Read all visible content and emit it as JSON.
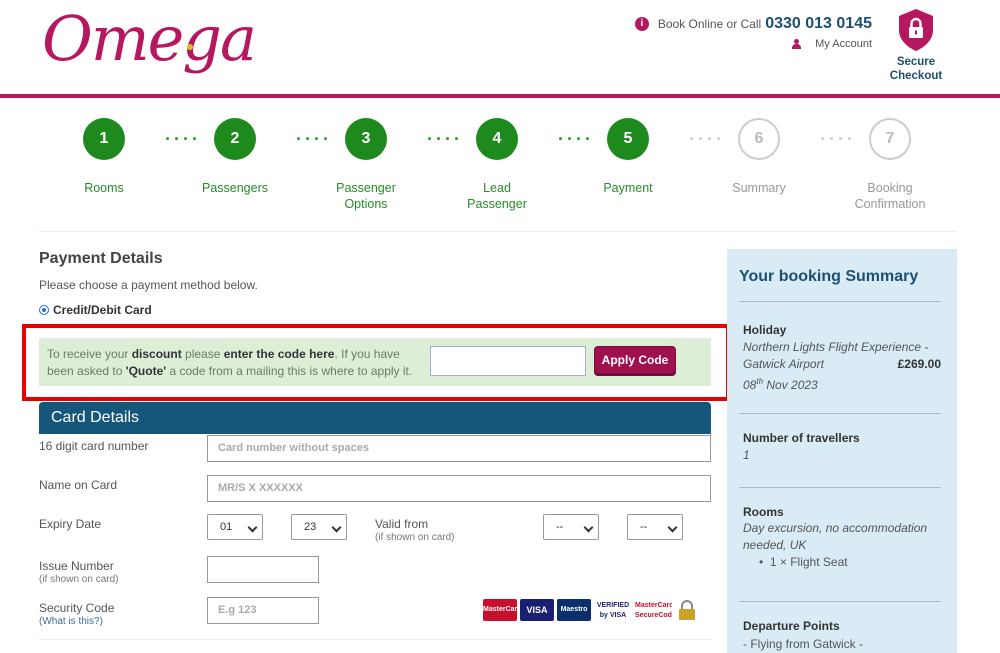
{
  "header": {
    "logo_text": "Omega",
    "call_text": "Book Online or Call",
    "phone": "0330 013 0145",
    "account_link": "My Account",
    "secure_line1": "Secure",
    "secure_line2": "Checkout"
  },
  "steps": [
    {
      "num": "1",
      "label": "Rooms",
      "state": "done"
    },
    {
      "num": "2",
      "label": "Passengers",
      "state": "done"
    },
    {
      "num": "3",
      "label": "Passenger Options",
      "state": "done"
    },
    {
      "num": "4",
      "label": "Lead Passenger",
      "state": "done"
    },
    {
      "num": "5",
      "label": "Payment",
      "state": "current"
    },
    {
      "num": "6",
      "label": "Summary",
      "state": "pending"
    },
    {
      "num": "7",
      "label": "Booking Confirmation",
      "state": "pending"
    }
  ],
  "payment": {
    "title": "Payment Details",
    "subtitle": "Please choose a payment method below.",
    "method_label": "Credit/Debit Card",
    "discount": {
      "t1": "To receive your ",
      "b1": "discount",
      "t2": " please ",
      "b2": "enter the code here",
      "t3": ". If you have been asked to ",
      "b3": "'Quote'",
      "t4": " a code from a mailing this is where to apply it.",
      "input_value": "",
      "button_label": "Apply Code"
    },
    "card_header": "Card Details",
    "fields": {
      "card_number_label": "16 digit card number",
      "card_number_placeholder": "Card number without spaces",
      "name_label": "Name on Card",
      "name_placeholder": "MR/S X XXXXXX",
      "expiry_label": "Expiry Date",
      "expiry_month": "01",
      "expiry_year": "23",
      "valid_from_label": "Valid from",
      "valid_from_note": "(if shown on card)",
      "valid_month": "--",
      "valid_year": "--",
      "issue_label": "Issue Number",
      "issue_note": "(if shown on card)",
      "security_label": "Security Code",
      "security_link": "(What is this?)",
      "security_placeholder": "E.g 123"
    },
    "card_logos": [
      "MasterCard",
      "VISA",
      "Maestro",
      "VERIFIED by VISA",
      "MasterCard SecureCode",
      "padlock"
    ]
  },
  "summary": {
    "title": "Your booking Summary",
    "holiday_heading": "Holiday",
    "holiday_name_line1": "Northern Lights Flight Experience -",
    "holiday_name_line2": "Gatwick Airport",
    "holiday_price": "£269.00",
    "holiday_date_day": "08",
    "holiday_date_suffix": "th",
    "holiday_date_rest": " Nov 2023",
    "travellers_heading": "Number of travellers",
    "travellers_value": "1",
    "rooms_heading": "Rooms",
    "rooms_line1": "Day excursion, no accommodation",
    "rooms_line2": "needed, UK",
    "rooms_item": "1 × Flight Seat",
    "departure_heading": "Departure Points",
    "departure_value": "- Flying from Gatwick -"
  }
}
